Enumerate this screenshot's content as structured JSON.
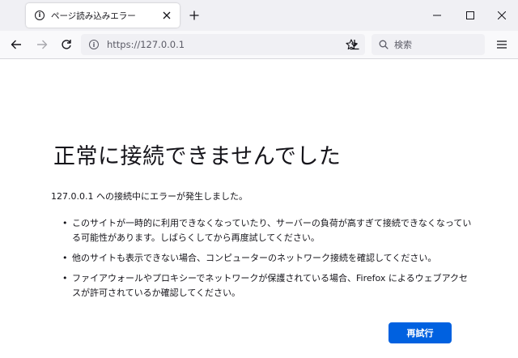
{
  "tab": {
    "title": "ページ読み込みエラー"
  },
  "address_bar": {
    "url": "https://127.0.0.1"
  },
  "search": {
    "placeholder": "検索"
  },
  "error": {
    "title": "正常に接続できませんでした",
    "description": "127.0.0.1 への接続中にエラーが発生しました。",
    "suggestions": [
      "このサイトが一時的に利用できなくなっていたり、サーバーの負荷が高すぎて接続できなくなっている可能性があります。しばらくしてから再度試してください。",
      "他のサイトも表示できない場合、コンピューターのネットワーク接続を確認してください。",
      "ファイアウォールやプロキシーでネットワークが保護されている場合、Firefox によるウェブアクセスが許可されているか確認してください。"
    ],
    "retry_label": "再試行"
  },
  "colors": {
    "primary_button": "#0061e0",
    "tab_strip": "#f0f0f4",
    "content_bg": "#ffffff"
  },
  "icons": {
    "tab": "info-icon",
    "url": "info-icon",
    "bookmark": "star-icon",
    "downloads": "download-icon",
    "search": "search-icon",
    "menu": "hamburger-icon"
  }
}
